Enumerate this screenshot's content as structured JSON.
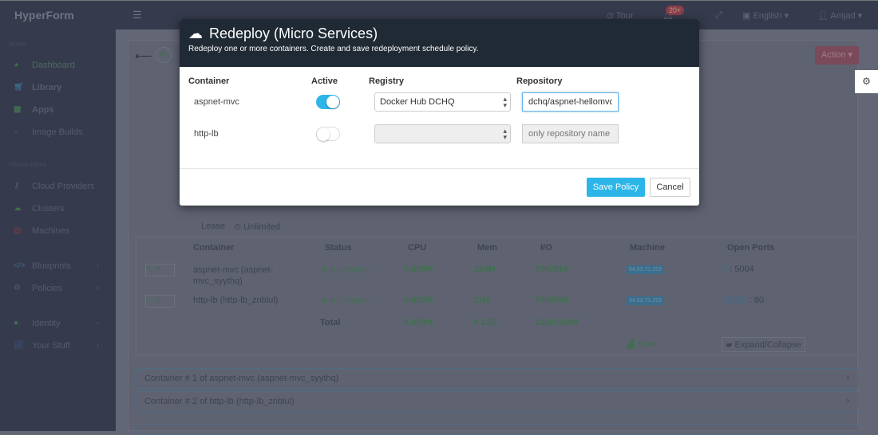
{
  "app": {
    "title": "HyperForm"
  },
  "topbar": {
    "tour": "Tour",
    "notifications": "20+",
    "language": "English",
    "user": "Amjad"
  },
  "sidebar": {
    "sections": [
      {
        "label": "Home",
        "items": [
          {
            "label": "Dashboard",
            "icon": "dashboard-icon"
          },
          {
            "label": "Library",
            "icon": "cart-icon"
          },
          {
            "label": "Apps",
            "icon": "grid-icon"
          },
          {
            "label": "Image Builds",
            "icon": "circle-icon"
          }
        ]
      },
      {
        "label": "Infrastructure",
        "items": [
          {
            "label": "Cloud Providers",
            "icon": "key-icon"
          },
          {
            "label": "Clusters",
            "icon": "cloud-icon"
          },
          {
            "label": "Machines",
            "icon": "server-icon"
          }
        ]
      },
      {
        "label": "",
        "items": [
          {
            "label": "Blueprints",
            "icon": "code-icon"
          },
          {
            "label": "Policies",
            "icon": "gear-icon"
          }
        ]
      },
      {
        "label": "",
        "items": [
          {
            "label": "Identity",
            "icon": "user-icon"
          },
          {
            "label": "Your Stuff",
            "icon": "chart-icon"
          }
        ]
      }
    ]
  },
  "page": {
    "action": "Action",
    "lease_label": "Lease",
    "lease_value": "Unlimited",
    "table": {
      "headers": [
        "Container",
        "Status",
        "CPU",
        "Mem",
        "I/O",
        "Machine",
        "Open Ports"
      ],
      "rows": [
        {
          "container": "aspnet-mvc (aspnet-mvc_syythq)",
          "status": "RUNNING",
          "cpu": "0.000%",
          "mem": "124M",
          "io": "27K/51K",
          "machine": "64.93.71.253",
          "port_link": "0",
          "port": ": 5004"
        },
        {
          "container": "http-lb (http-lb_znblul)",
          "status": "RUNNING",
          "cpu": "0.002%",
          "mem": "11M",
          "io": "76K/58K",
          "machine": "64.93.71.253",
          "port_link": "32832",
          "port": ": 80"
        }
      ],
      "total": {
        "label": "Total",
        "cpu": "0.003%",
        "mem": "0.13G",
        "io": "103K/109K"
      },
      "stats": "Stats",
      "expand": "Expand/Collapse"
    },
    "accordions": [
      "Container # 1 of aspnet-mvc (aspnet-mvc_syythq)",
      "Container # 2 of http-lb (http-lb_znblul)"
    ]
  },
  "modal": {
    "title": "Redeploy (Micro Services)",
    "subtitle": "Redeploy one or more containers. Create and save redeployment schedule policy.",
    "headers": {
      "container": "Container",
      "active": "Active",
      "registry": "Registry",
      "repository": "Repository"
    },
    "rows": [
      {
        "container": "aspnet-mvc",
        "active": true,
        "registry": "Docker Hub DCHQ",
        "repository": "dchq/aspnet-hellomvc",
        "placeholder": ""
      },
      {
        "container": "http-lb",
        "active": false,
        "registry": "",
        "repository": "",
        "placeholder": "only repository name"
      }
    ],
    "save": "Save Policy",
    "cancel": "Cancel",
    "accent": "#2bb5e8"
  }
}
